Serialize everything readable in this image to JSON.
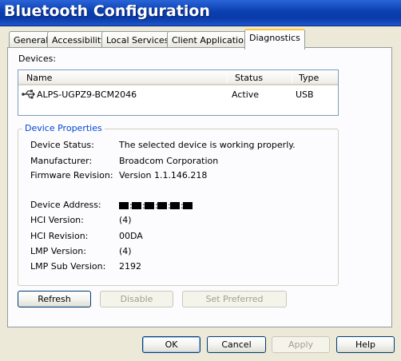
{
  "window": {
    "title": "Bluetooth Configuration"
  },
  "tabs": [
    {
      "label": "General",
      "active": false
    },
    {
      "label": "Accessibility",
      "active": false
    },
    {
      "label": "Local Services",
      "active": false
    },
    {
      "label": "Client Applications",
      "active": false
    },
    {
      "label": "Diagnostics",
      "active": true
    }
  ],
  "devices": {
    "label": "Devices:",
    "columns": [
      "Name",
      "Status",
      "Type"
    ],
    "rows": [
      {
        "icon": "usb-icon",
        "name": "ALPS-UGPZ9-BCM2046",
        "status": "Active",
        "type": "USB"
      }
    ]
  },
  "device_properties": {
    "title": "Device Properties",
    "items": [
      {
        "label": "Device Status:",
        "value": "The selected device is working properly."
      },
      {
        "label": "Manufacturer:",
        "value": "Broadcom Corporation"
      },
      {
        "label": "Firmware Revision:",
        "value": "Version 1.1.146.218"
      },
      {
        "label": "Device Address:",
        "value": "redacted"
      },
      {
        "label": "HCI Version:",
        "value": "(4)"
      },
      {
        "label": "HCI Revision:",
        "value": "00DA"
      },
      {
        "label": "LMP Version:",
        "value": "(4)"
      },
      {
        "label": "LMP Sub Version:",
        "value": "2192"
      }
    ]
  },
  "panel_buttons": {
    "refresh": "Refresh",
    "disable": "Disable",
    "set_preferred": "Set Preferred"
  },
  "dialog_buttons": {
    "ok": "OK",
    "cancel": "Cancel",
    "apply": "Apply",
    "help": "Help"
  }
}
